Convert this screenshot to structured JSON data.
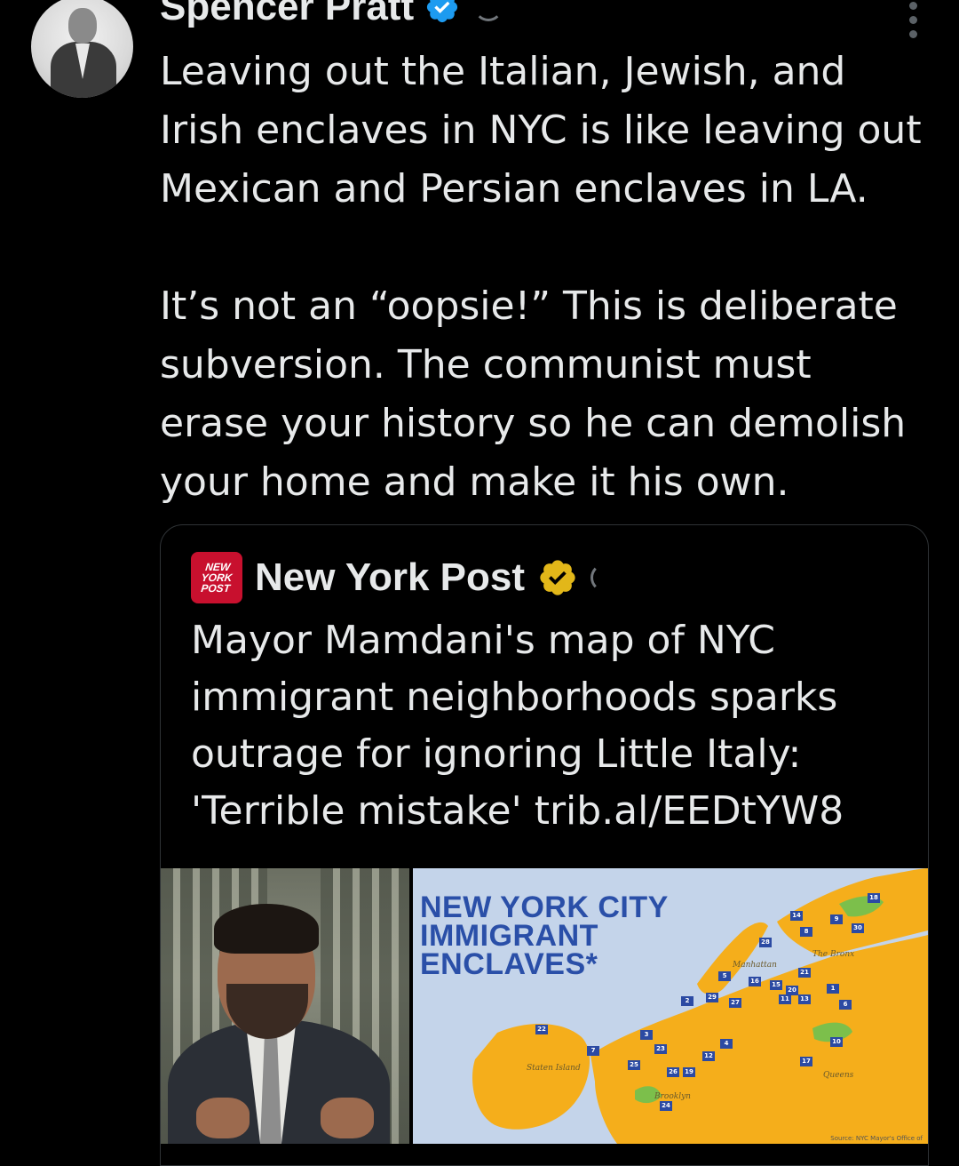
{
  "tweet": {
    "author": "Spencer Pratt",
    "text": "Leaving out the Italian, Jewish, and\nIrish enclaves in NYC is like leaving out\nMexican and Persian enclaves in LA.\n\nIt’s not an “oopsie!” This is deliberate\nsubversion. The communist must\nerase your history so he can demolish\nyour home and make it his own.",
    "verified_icon": "blue-verified-check-icon",
    "more_icon": "more-vertical-icon"
  },
  "quote": {
    "author": "New York Post",
    "logo_text": "NEW YORK POST",
    "verified_icon": "gold-verified-check-icon",
    "text": "Mayor Mamdani's map of NYC immigrant neighborhoods sparks outrage for ignoring Little Italy: 'Terrible mistake' trib.al/EEDtYW8"
  },
  "map": {
    "title_lines": [
      "NEW YORK CITY",
      "IMMIGRANT",
      "ENCLAVES*"
    ],
    "labels": [
      "Manhattan",
      "The Bronx",
      "Staten Island",
      "Queens",
      "Brooklyn"
    ],
    "source": "Source: NYC Mayor's Office of",
    "flags": [
      "18",
      "14",
      "9",
      "30",
      "28",
      "8",
      "5",
      "16",
      "15",
      "20",
      "21",
      "1",
      "11",
      "13",
      "6",
      "2",
      "29",
      "27",
      "22",
      "3",
      "23",
      "4",
      "12",
      "7",
      "25",
      "26",
      "19",
      "10",
      "17",
      "24"
    ],
    "colors": {
      "land": "#f5ae1b",
      "water": "#c4d4ea",
      "park": "#7cbf4b",
      "flag": "#2b4aa3",
      "title": "#2a4fa8"
    }
  },
  "colors": {
    "background": "#000000",
    "text": "#e7e9ea",
    "verified_blue": "#1d9bf0",
    "verified_gold": "#e2b719",
    "nyp_red": "#c8102e"
  }
}
